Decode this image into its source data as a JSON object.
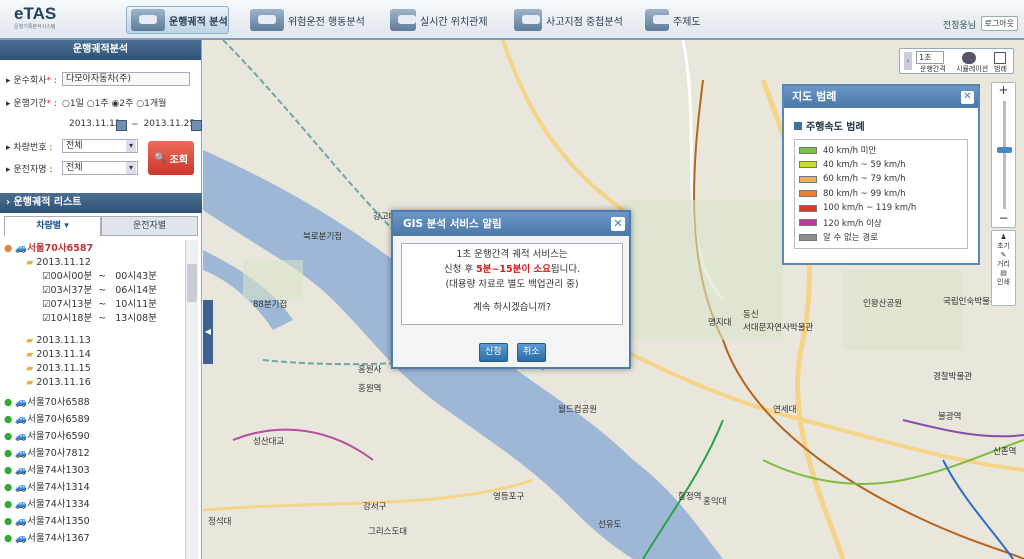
{
  "app": {
    "name": "eTAS",
    "subtitle": "운행기록분석시스템"
  },
  "nav": [
    "운행궤적 분석",
    "위험운전 행동분석",
    "실시간 위치관제",
    "사고지점 중첩분석",
    "주제도"
  ],
  "user": {
    "name": "전정웅님",
    "logout": "로그아웃"
  },
  "sidebar": {
    "panel_title": "운행궤적분석",
    "company_label": "운수회사",
    "company_value": "다모아자동차(주)",
    "period_label": "운행기간",
    "period_options": [
      "1일",
      "1주",
      "2주",
      "1개월"
    ],
    "period_selected": "2주",
    "date_from": "2013.11.12",
    "date_sep": "~",
    "date_to": "2013.11.25",
    "vehicle_label": "차량번호",
    "vehicle_value": "전체",
    "driver_label": "운전자명",
    "driver_value": "전체",
    "search_label": "조회",
    "list_title": "운행궤적 리스트",
    "tab_vehicle": "차량별",
    "tab_driver": "운전자별",
    "tree": {
      "root": "서울70사6587",
      "date_open": "2013.11.12",
      "trips": [
        {
          "start": "00시00분",
          "end": "00시43분"
        },
        {
          "start": "03시37분",
          "end": "06시14분"
        },
        {
          "start": "07시13분",
          "end": "10시11분"
        },
        {
          "start": "10시18분",
          "end": "13시08분"
        }
      ],
      "dates": [
        "2013.11.13",
        "2013.11.14",
        "2013.11.15",
        "2013.11.16"
      ],
      "vehicles": [
        "서울70사6588",
        "서울70사6589",
        "서울70사6590",
        "서울70사7812",
        "서울74사1303",
        "서울74사1314",
        "서울74사1334",
        "서울74사1350",
        "서울74사1367"
      ]
    }
  },
  "map_controls": {
    "interval": "1초",
    "interval_label": "운행간격",
    "sim_label": "시뮬레이션",
    "legend_btn": "범례",
    "tools": [
      "초기",
      "거리",
      "인쇄"
    ]
  },
  "legend": {
    "title": "지도 범례",
    "subtitle": "주행속도 범례",
    "items": [
      {
        "label": "40 km/h 미만",
        "color": "#7ac143"
      },
      {
        "label": "40 km/h ~ 59 km/h",
        "color": "#c8d943"
      },
      {
        "label": "60 km/h ~ 79 km/h",
        "color": "#f2b33d"
      },
      {
        "label": "80 km/h ~ 99 km/h",
        "color": "#ee7d2c"
      },
      {
        "label": "100 km/h ~ 119 km/h",
        "color": "#d93a2b"
      },
      {
        "label": "120 km/h 이상",
        "color": "#c0399a"
      },
      {
        "label": "알 수 없는 경로",
        "color": "#8c8c8c"
      }
    ]
  },
  "dialog": {
    "title": "GIS 분석 서비스 알림",
    "line1": "1초 운행간격 궤적 서비스는",
    "line2_pre": "신청 후 ",
    "line2_em": "5분~15분이 소요",
    "line2_post": "됩니다.",
    "line3": "(대용량 자료로 별도 백업관리 중)",
    "line4": "계속 하시겠습니까?",
    "ok": "신청",
    "cancel": "취소"
  },
  "map_labels": [
    "강고대",
    "북로분기점",
    "88분기점",
    "홍원사",
    "흥원역",
    "월드컵공원",
    "명지대",
    "서대문자연사박물관",
    "연세대",
    "인왕산공원",
    "국립인숙박물관",
    "그리스도대",
    "영등포구",
    "강서구",
    "선유도",
    "홍익대",
    "합정역",
    "성산대교",
    "경찰박물관",
    "불광역",
    "신촌역",
    "정석대",
    "동신"
  ]
}
